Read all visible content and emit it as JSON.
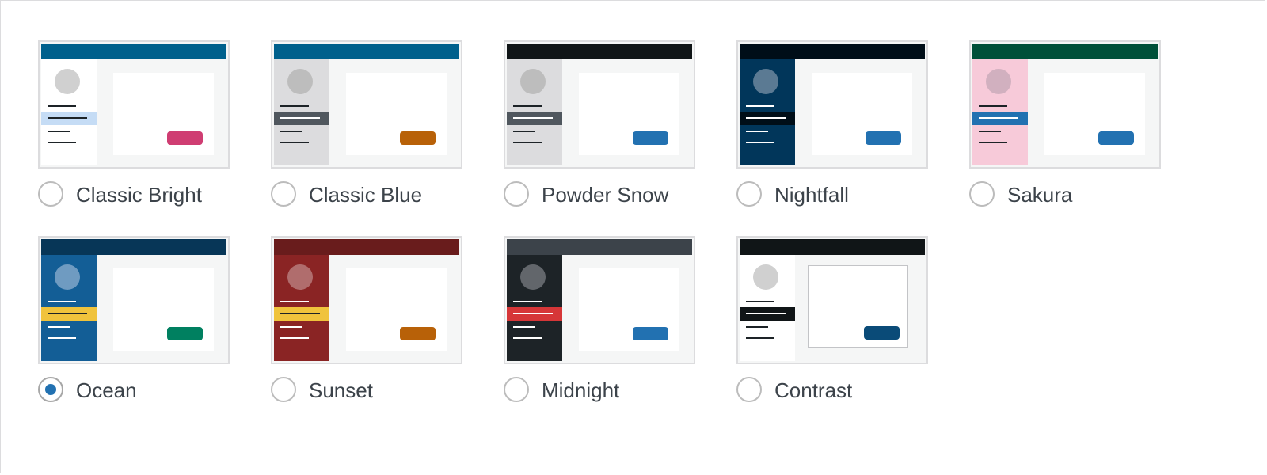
{
  "selected": "ocean",
  "schemes": [
    {
      "id": "classic-bright",
      "label": "Classic Bright",
      "colors": {
        "bar": "#00608c",
        "side": "#ffffff",
        "avatar": "#d0d0d0",
        "lines": "#1d2327",
        "band": "#c5dcf5",
        "band_line": "#1d2327",
        "content": "#ffffff",
        "content_border": "",
        "button": "#cf3d72"
      }
    },
    {
      "id": "classic-blue",
      "label": "Classic Blue",
      "colors": {
        "bar": "#00608c",
        "side": "#dcdcde",
        "avatar": "#bdbdbd",
        "lines": "#1d2327",
        "band": "#50575e",
        "band_line": "#ffffff",
        "content": "#ffffff",
        "content_border": "",
        "button": "#b86108"
      }
    },
    {
      "id": "powder-snow",
      "label": "Powder Snow",
      "colors": {
        "bar": "#101517",
        "side": "#dcdcde",
        "avatar": "#bdbdbd",
        "lines": "#1d2327",
        "band": "#50575e",
        "band_line": "#ffffff",
        "content": "#ffffff",
        "content_border": "",
        "button": "#2271b1"
      }
    },
    {
      "id": "nightfall",
      "label": "Nightfall",
      "colors": {
        "bar": "#000e18",
        "side": "#01365a",
        "avatar": "#5b7a93",
        "lines": "#ffffff",
        "band": "#000e18",
        "band_line": "#ffffff",
        "content": "#ffffff",
        "content_border": "",
        "button": "#2271b1"
      }
    },
    {
      "id": "sakura",
      "label": "Sakura",
      "colors": {
        "bar": "#005039",
        "side": "#f7cad9",
        "avatar": "#d1b0bf",
        "lines": "#1d2327",
        "band": "#2271b1",
        "band_line": "#ffffff",
        "content": "#ffffff",
        "content_border": "",
        "button": "#2271b1"
      }
    },
    {
      "id": "ocean",
      "label": "Ocean",
      "colors": {
        "bar": "#073657",
        "side": "#135e96",
        "avatar": "#6f9bc1",
        "lines": "#ffffff",
        "band": "#f0c33c",
        "band_line": "#1d2327",
        "content": "#ffffff",
        "content_border": "",
        "button": "#008060"
      }
    },
    {
      "id": "sunset",
      "label": "Sunset",
      "colors": {
        "bar": "#691c1c",
        "side": "#8a2424",
        "avatar": "#b06d6d",
        "lines": "#ffffff",
        "band": "#f0c33c",
        "band_line": "#1d2327",
        "content": "#ffffff",
        "content_border": "",
        "button": "#b86108"
      }
    },
    {
      "id": "midnight",
      "label": "Midnight",
      "colors": {
        "bar": "#3c434a",
        "side": "#1d2327",
        "avatar": "#62666b",
        "lines": "#ffffff",
        "band": "#d63638",
        "band_line": "#ffffff",
        "content": "#ffffff",
        "content_border": "",
        "button": "#2271b1"
      }
    },
    {
      "id": "contrast",
      "label": "Contrast",
      "colors": {
        "bar": "#101517",
        "side": "#ffffff",
        "avatar": "#d0d0d0",
        "lines": "#1d2327",
        "band": "#101517",
        "band_line": "#ffffff",
        "content": "#ffffff",
        "content_border": "#c3c4c7",
        "button": "#0a4b78"
      }
    }
  ]
}
